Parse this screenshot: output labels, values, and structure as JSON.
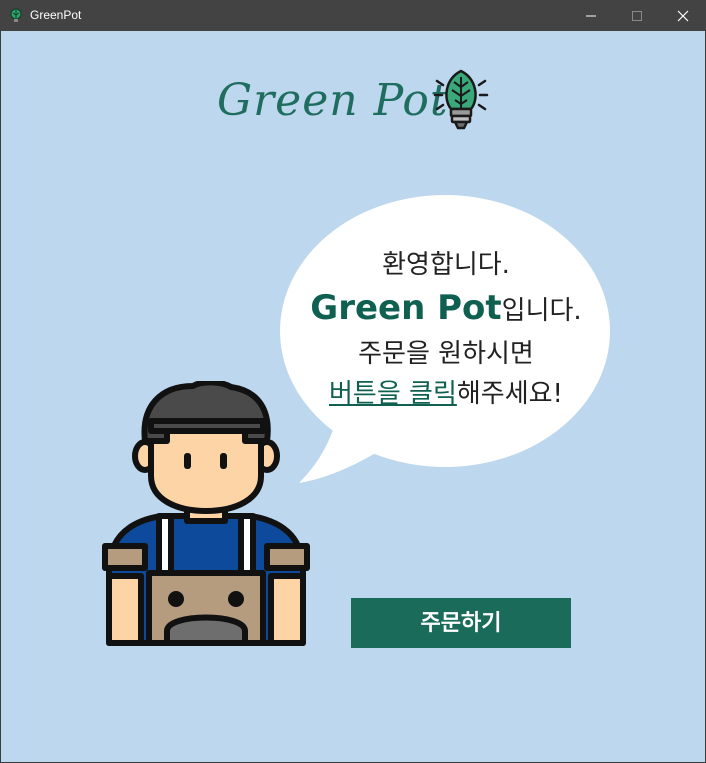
{
  "window": {
    "title": "GreenPot",
    "icons": [
      "app-leaf-icon",
      "minimize-icon",
      "maximize-icon",
      "close-icon"
    ]
  },
  "logo": {
    "text": "Green Pot",
    "icon": "leaf-bulb-icon"
  },
  "speech": {
    "line1": "환영합니다.",
    "brand": "Green Pot",
    "line2_suffix": "입니다.",
    "line3": "주문을 원하시면",
    "highlight": "버튼을 클릭",
    "line4_suffix": "해주세요!"
  },
  "order_button": {
    "label": "주문하기"
  },
  "colors": {
    "background": "#bdd7ee",
    "brand_green": "#1b6b5a",
    "titlebar": "#434343",
    "apron_blue": "#0d4a9b",
    "skin": "#fdd4a6"
  }
}
